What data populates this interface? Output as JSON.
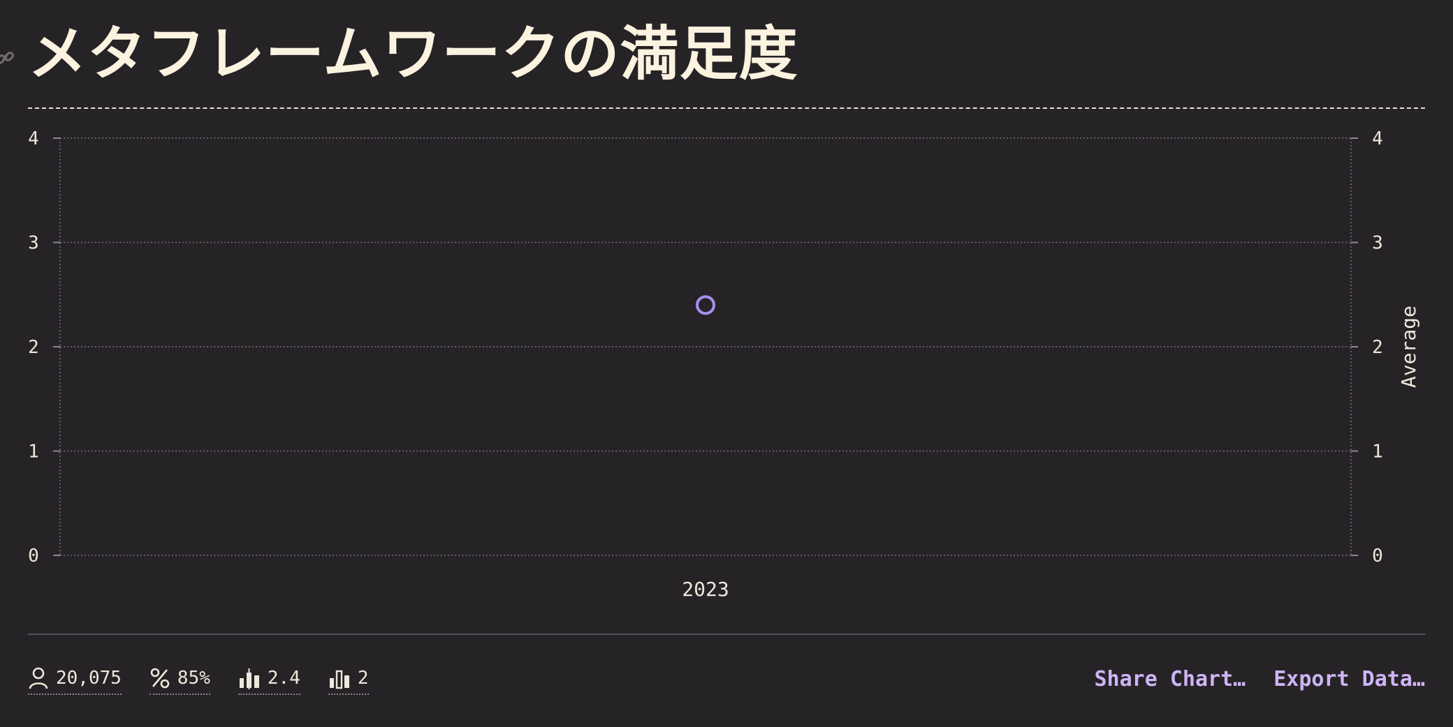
{
  "page": {
    "title": "メタフレームワークの満足度"
  },
  "chart_data": {
    "type": "scatter",
    "title": "メタフレームワークの満足度",
    "categories": [
      "2023"
    ],
    "series": [
      {
        "values": [
          2.4
        ],
        "color": "#a98ef0"
      }
    ],
    "ylim": [
      0,
      4
    ],
    "yticks": [
      0,
      1,
      2,
      3,
      4
    ],
    "y_right_label": "Average",
    "grid": true,
    "marker": "hollow-circle"
  },
  "footer": {
    "stats": [
      {
        "icon": "user-icon",
        "value": "20,075"
      },
      {
        "icon": "percent-icon",
        "value": "85%"
      },
      {
        "icon": "boxplot-icon",
        "value": "2.4"
      },
      {
        "icon": "bar-chart-icon",
        "value": "2"
      }
    ],
    "actions": {
      "share_label": "Share Chart…",
      "export_label": "Export Data…"
    }
  },
  "colors": {
    "background": "#262326",
    "text": "#f5f0e1",
    "accent": "#cdb4f5",
    "marker": "#a98ef0"
  }
}
